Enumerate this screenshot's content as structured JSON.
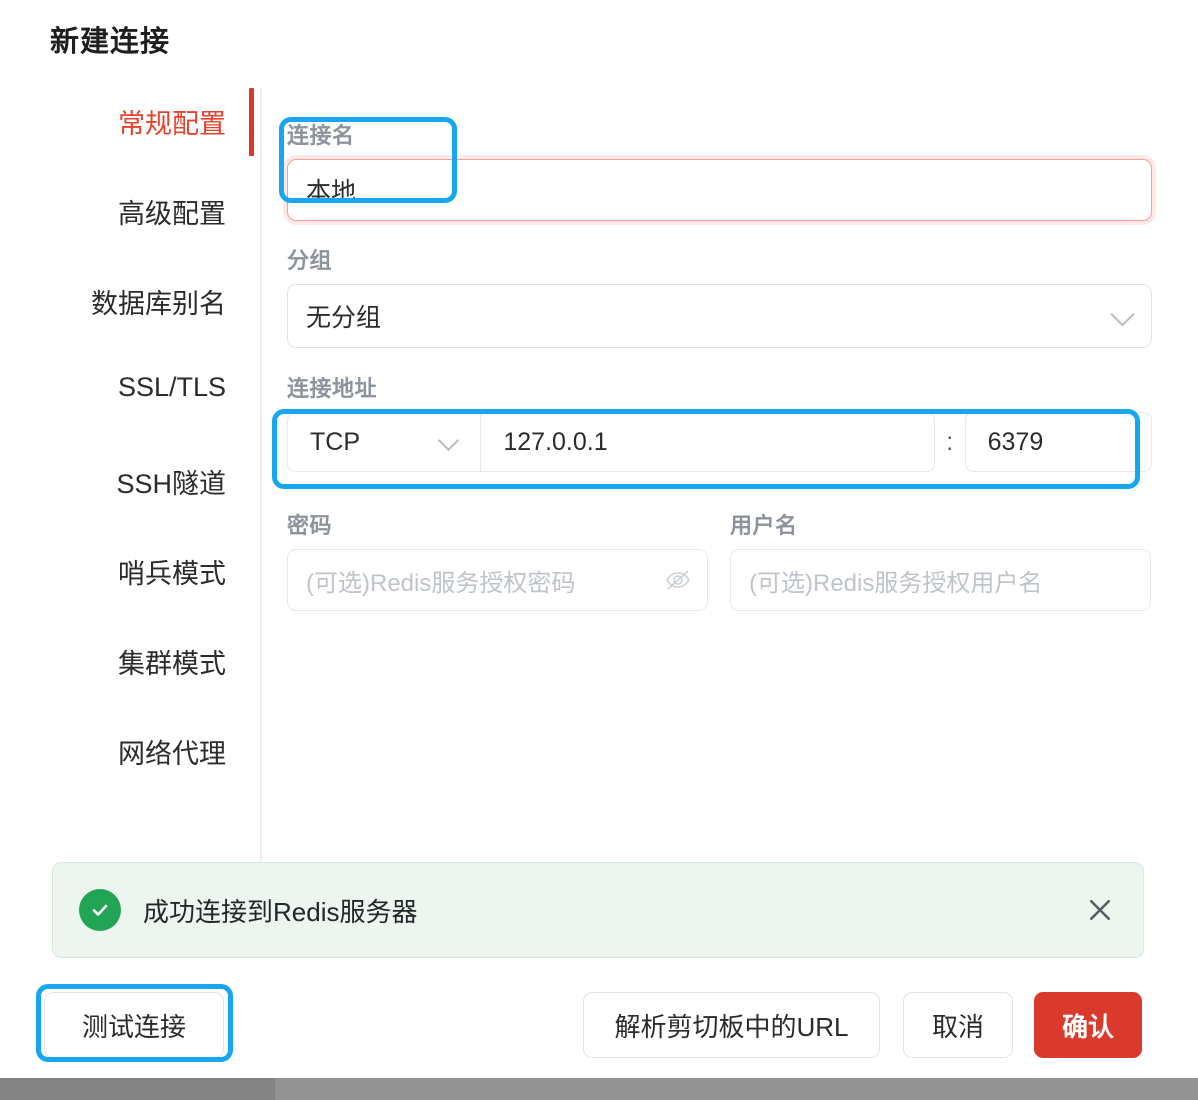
{
  "dialog": {
    "title": "新建连接"
  },
  "sidebar": {
    "items": [
      {
        "label": "常规配置",
        "active": true
      },
      {
        "label": "高级配置",
        "active": false
      },
      {
        "label": "数据库别名",
        "active": false
      },
      {
        "label": "SSL/TLS",
        "active": false
      },
      {
        "label": "SSH隧道",
        "active": false
      },
      {
        "label": "哨兵模式",
        "active": false
      },
      {
        "label": "集群模式",
        "active": false
      },
      {
        "label": "网络代理",
        "active": false
      }
    ]
  },
  "form": {
    "connection_name": {
      "label": "连接名",
      "value": "本地",
      "state": "error"
    },
    "group": {
      "label": "分组",
      "value": "无分组",
      "icon": "chevron-down-icon"
    },
    "address": {
      "label": "连接地址",
      "protocol": "TCP",
      "host": "127.0.0.1",
      "separator": ":",
      "port": "6379"
    },
    "password": {
      "label": "密码",
      "value": "",
      "placeholder": "(可选)Redis服务授权密码",
      "icon": "eye-off-icon"
    },
    "username": {
      "label": "用户名",
      "value": "",
      "placeholder": "(可选)Redis服务授权用户名"
    }
  },
  "alert": {
    "message": "成功连接到Redis服务器",
    "type": "success",
    "icon": "check-circle-icon",
    "close_icon": "close-icon"
  },
  "footer": {
    "test_label": "测试连接",
    "parse_label": "解析剪切板中的URL",
    "cancel_label": "取消",
    "confirm_label": "确认"
  },
  "colors": {
    "accent_red": "#d93a2b",
    "active_tab_red": "#e8412d",
    "highlight_blue": "#16a7f0",
    "success_green": "#21a453",
    "alert_bg": "#ecf6ef",
    "error_border": "#fb9b95",
    "label_gray": "#8d939c",
    "placeholder_gray": "#bfc4cb"
  }
}
